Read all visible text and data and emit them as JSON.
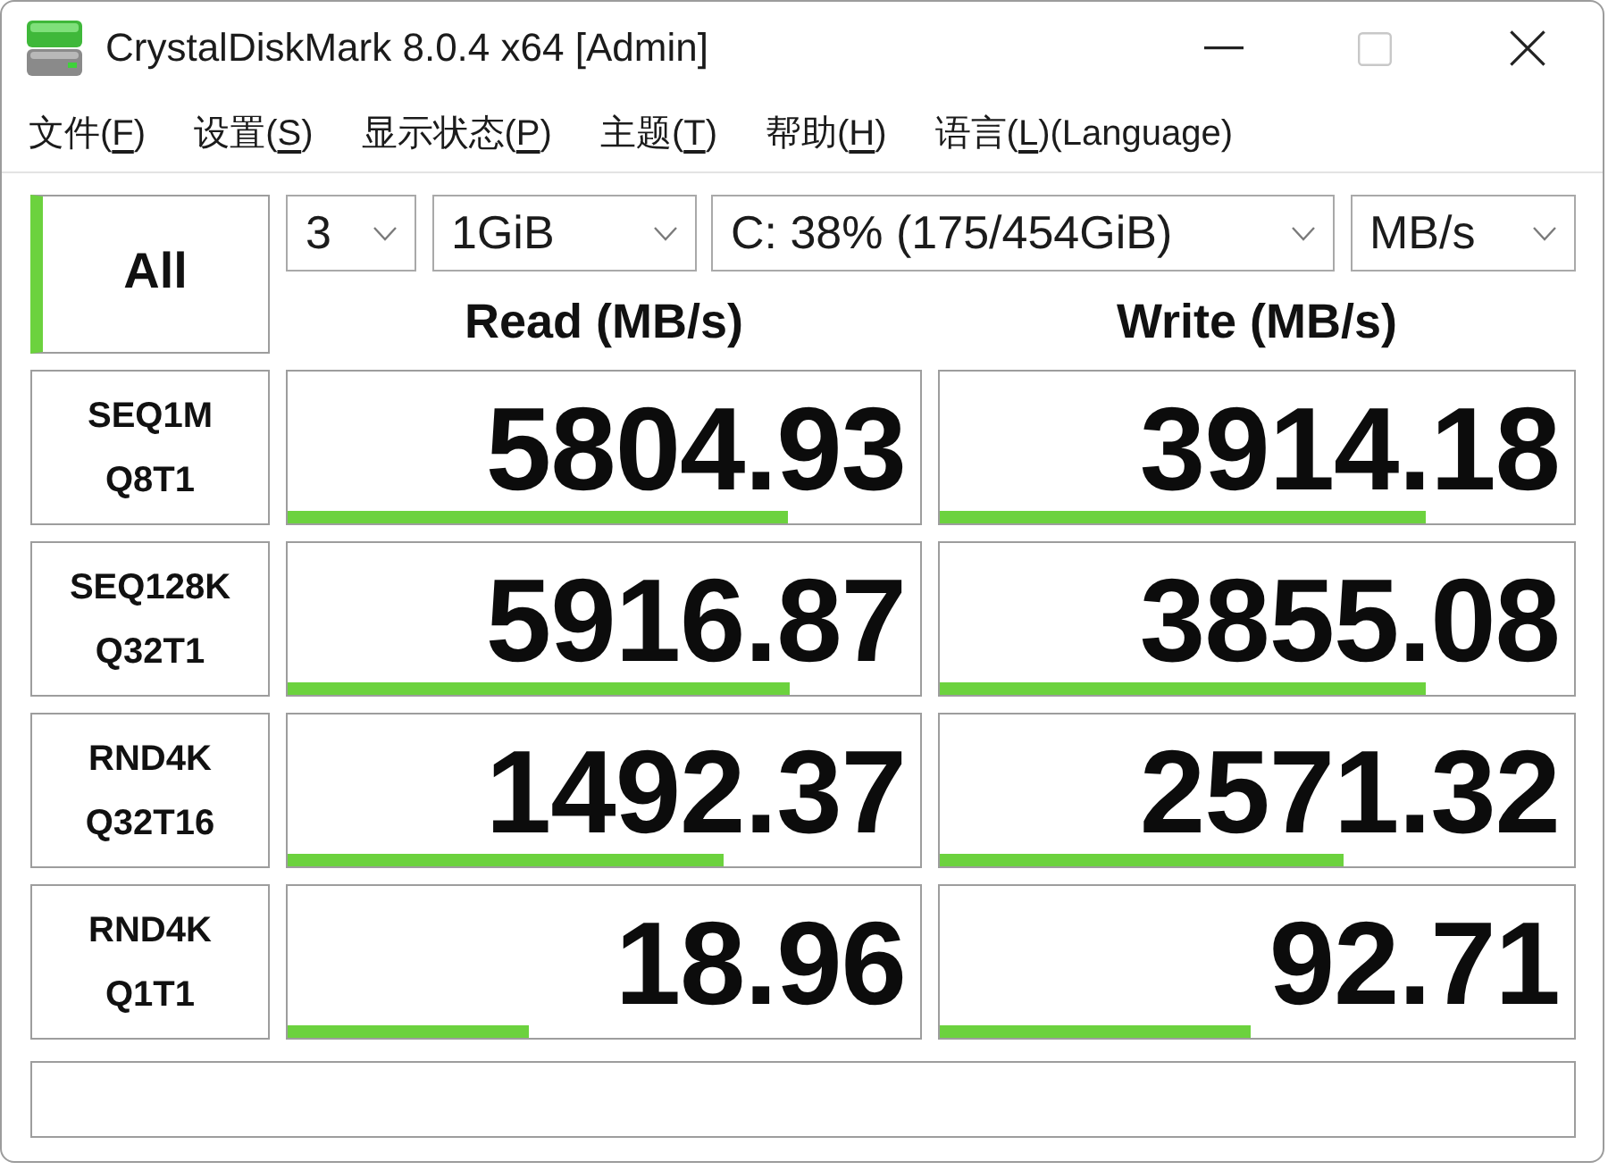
{
  "window": {
    "title": "CrystalDiskMark 8.0.4 x64 [Admin]",
    "maximize": {
      "disabled": true
    }
  },
  "menu": [
    {
      "before": "文件(",
      "key": "F",
      "after": ")"
    },
    {
      "before": "设置(",
      "key": "S",
      "after": ")"
    },
    {
      "before": "显示状态(",
      "key": "P",
      "after": ")"
    },
    {
      "before": "主题(",
      "key": "T",
      "after": ")"
    },
    {
      "before": "帮助(",
      "key": "H",
      "after": ")"
    },
    {
      "before": "语言(",
      "key": "L",
      "after": ")(Language)"
    }
  ],
  "all_button": {
    "label": "All"
  },
  "settings": [
    {
      "kind": "count",
      "value": "3"
    },
    {
      "kind": "size",
      "value": "1GiB"
    },
    {
      "kind": "drive",
      "value": "C: 38% (175/454GiB)"
    },
    {
      "kind": "unit",
      "value": "MB/s"
    }
  ],
  "columns": [
    "Read (MB/s)",
    "Write (MB/s)"
  ],
  "tests": [
    {
      "name": "SEQ1M",
      "params": "Q8T1",
      "read": {
        "value": "5804.93",
        "level": 0.79
      },
      "write": {
        "value": "3914.18",
        "level": 0.765
      }
    },
    {
      "name": "SEQ128K",
      "params": "Q32T1",
      "read": {
        "value": "5916.87",
        "level": 0.795
      },
      "write": {
        "value": "3855.08",
        "level": 0.765
      }
    },
    {
      "name": "RND4K",
      "params": "Q32T16",
      "read": {
        "value": "1492.37",
        "level": 0.69
      },
      "write": {
        "value": "2571.32",
        "level": 0.636
      }
    },
    {
      "name": "RND4K",
      "params": "Q1T1",
      "read": {
        "value": "18.96",
        "level": 0.38
      },
      "write": {
        "value": "92.71",
        "level": 0.49
      }
    }
  ]
}
